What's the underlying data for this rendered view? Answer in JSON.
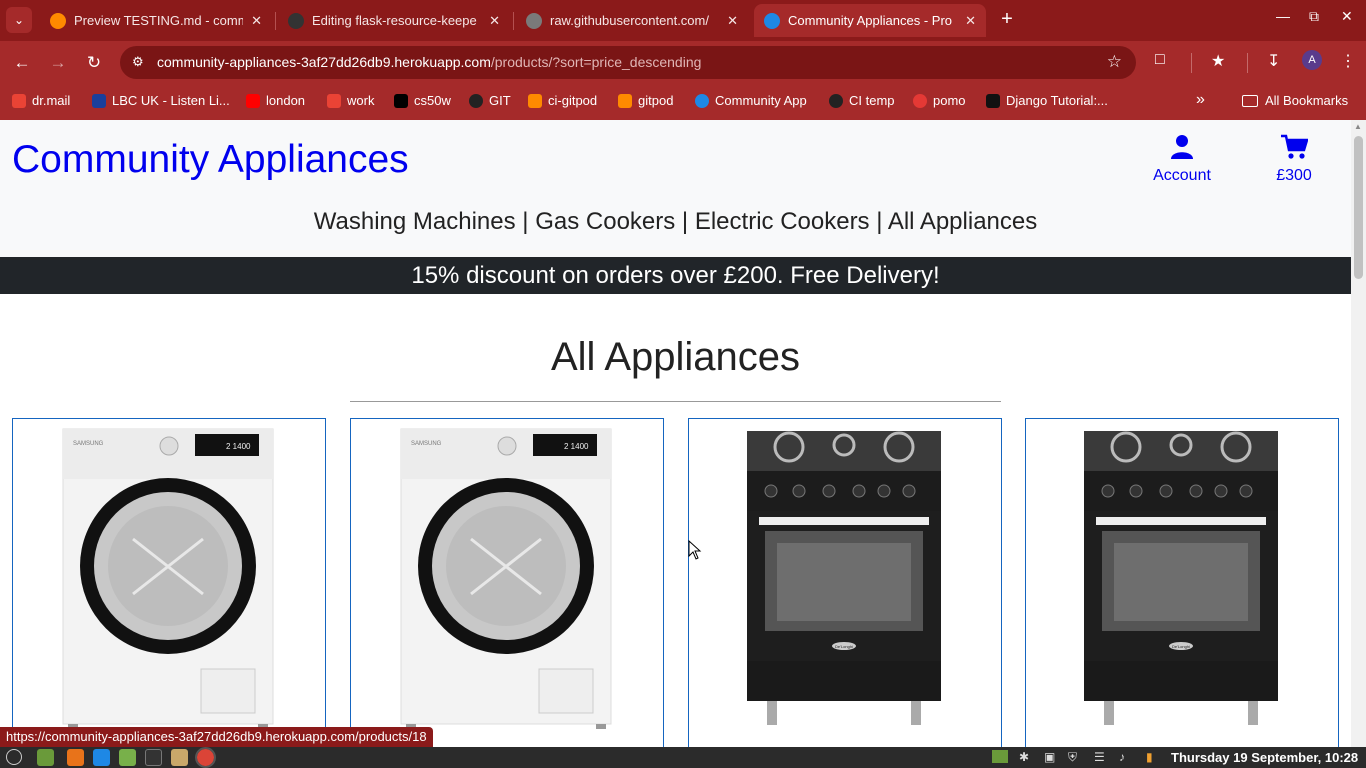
{
  "browser": {
    "tabs": [
      {
        "title": "Preview TESTING.md - comm",
        "favicon": "gitpod-icon",
        "active": false
      },
      {
        "title": "Editing flask-resource-keepe",
        "favicon": "github-icon",
        "active": false
      },
      {
        "title": "raw.githubusercontent.com/",
        "favicon": "globe-icon",
        "active": false
      },
      {
        "title": "Community Appliances - Pro",
        "favicon": "wca-icon",
        "active": true
      }
    ],
    "new_tab": "+",
    "url_host": "community-appliances-3af27dd26db9.herokuapp.com",
    "url_path": "/products/?sort=price_descending",
    "profile_initial": "A",
    "bookmarks": [
      {
        "label": "dr.mail",
        "icon": "gmail-icon",
        "color": "#ea4335"
      },
      {
        "label": "LBC UK - Listen Li...",
        "icon": "lbc-icon",
        "color": "#1a3f9c"
      },
      {
        "label": "london",
        "icon": "youtube-icon",
        "color": "#ff0000"
      },
      {
        "label": "work",
        "icon": "gmail-icon",
        "color": "#ea4335"
      },
      {
        "label": "cs50w",
        "icon": "x-icon",
        "color": "#000000"
      },
      {
        "label": "GIT",
        "icon": "github-icon",
        "color": "#222222"
      },
      {
        "label": "ci-gitpod",
        "icon": "gitpod-icon",
        "color": "#ff8a00"
      },
      {
        "label": "gitpod",
        "icon": "gitpod-icon",
        "color": "#ff8a00"
      },
      {
        "label": "Community App",
        "icon": "wca-icon",
        "color": "#1e88e5"
      },
      {
        "label": "CI temp",
        "icon": "github-icon",
        "color": "#222222"
      },
      {
        "label": "pomo",
        "icon": "tomato-icon",
        "color": "#e53935"
      },
      {
        "label": "Django Tutorial:...",
        "icon": "mdn-icon",
        "color": "#111111"
      }
    ],
    "all_bookmarks": "All Bookmarks",
    "status_url": "https://community-appliances-3af27dd26db9.herokuapp.com/products/18"
  },
  "site": {
    "brand": "Community Appliances",
    "account_label": "Account",
    "cart_total": "£300",
    "nav": [
      {
        "label": "Washing Machines",
        "sep": " |"
      },
      {
        "label": "Gas Cookers",
        "sep": " |"
      },
      {
        "label": "Electric Cookers",
        "sep": " |"
      },
      {
        "label": "All Appliances",
        "sep": ""
      }
    ],
    "banner": "15% discount on orders over £200. Free Delivery!",
    "page_title": "All Appliances",
    "products": [
      {
        "kind": "washing-machine",
        "brand_text": "SAMSUNG",
        "display": "2 1400"
      },
      {
        "kind": "washing-machine",
        "brand_text": "SAMSUNG",
        "display": "2 1400"
      },
      {
        "kind": "cooker",
        "brand_text": "De'Longhi"
      },
      {
        "kind": "cooker",
        "brand_text": "De'Longhi"
      }
    ]
  },
  "taskbar": {
    "clock": "Thursday 19 September, 10:28"
  },
  "colors": {
    "chrome": "#a52a2a",
    "link": "#0000ee",
    "banner": "#212529",
    "card_border": "#1565c0"
  }
}
